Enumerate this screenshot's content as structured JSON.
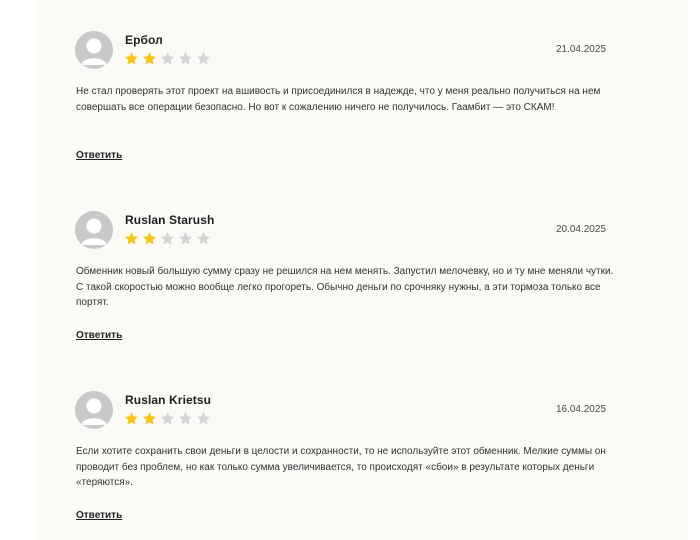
{
  "reviews": [
    {
      "author": "Ербол",
      "rating": 2,
      "max_rating": 5,
      "date": "21.04.2025",
      "text": "Не стал проверять этот проект на вшивость и присоединился в надежде, что у меня реально получиться на нем совершать все операции безопасно. Но вот к сожалению ничего не получилось. Гаамбит — это СКАМ!",
      "reply_label": "Ответить"
    },
    {
      "author": "Ruslan Starush",
      "rating": 2,
      "max_rating": 5,
      "date": "20.04.2025",
      "text": "Обменник новый большую сумму сразу не решился на нем менять. Запустил мелочевку, но и ту мне меняли чутки. С такой скоростью можно вообще легко прогореть. Обычно деньги по срочняку нужны, а эти тормоза только все портят.",
      "reply_label": "Ответить"
    },
    {
      "author": "Ruslan Krietsu",
      "rating": 2,
      "max_rating": 5,
      "date": "16.04.2025",
      "text": "Если хотите сохранить свои деньги в целости и сохранности, то не используйте этот обменник. Мелкие суммы он проводит без проблем, но как только сумма увеличивается, то происходят «сбои» в результате которых деньги «теряются».",
      "reply_label": "Ответить"
    }
  ],
  "colors": {
    "star_filled": "#f5c518",
    "star_empty": "#d4d4d4",
    "avatar_bg": "#c9c9c9",
    "avatar_fg": "#ffffff"
  },
  "icons": {
    "avatar": "user-silhouette-icon",
    "star": "star-icon"
  }
}
